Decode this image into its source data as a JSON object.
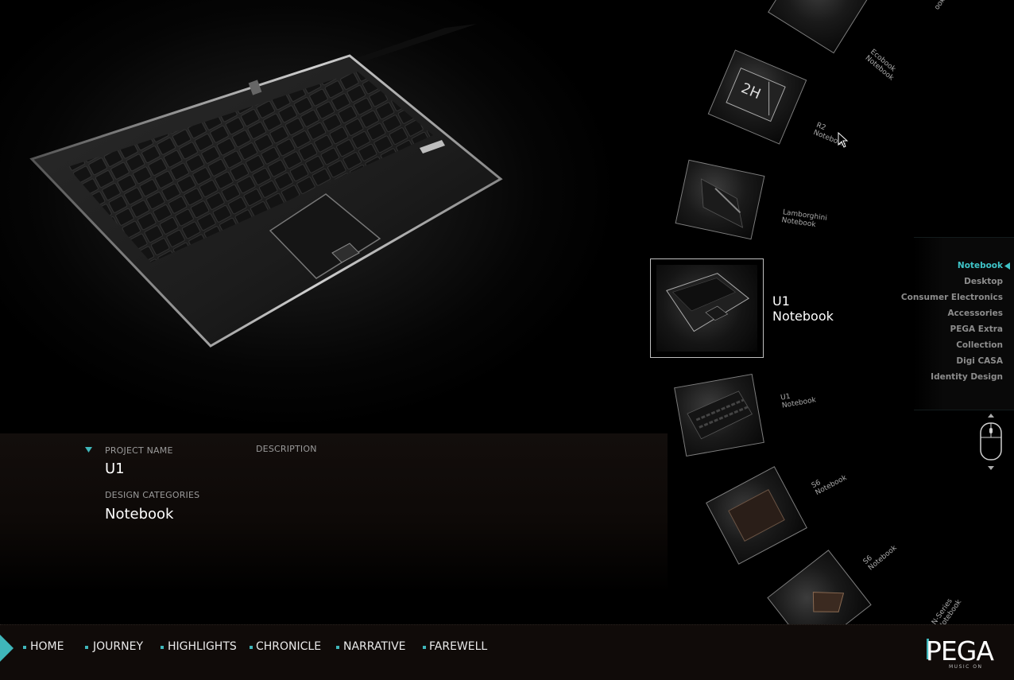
{
  "project": {
    "name_label": "PROJECT NAME",
    "name": "U1",
    "categories_label": "DESIGN CATEGORIES",
    "category": "Notebook",
    "description_label": "DESCRIPTION"
  },
  "carousel": {
    "items": [
      {
        "line1": "",
        "line2": "ook"
      },
      {
        "line1": "Ecobook",
        "line2": "Notebook"
      },
      {
        "line1": "R2",
        "line2": "Notebook"
      },
      {
        "line1": "Lamborghini",
        "line2": "Notebook"
      },
      {
        "line1": "U1",
        "line2": "Notebook"
      },
      {
        "line1": "U1",
        "line2": "Notebook"
      },
      {
        "line1": "S6",
        "line2": "Notebook"
      },
      {
        "line1": "S6",
        "line2": "Notebook"
      },
      {
        "line1": "N-Series",
        "line2": "Notebook"
      }
    ]
  },
  "categories": [
    {
      "label": "Notebook",
      "active": true
    },
    {
      "label": "Desktop",
      "active": false
    },
    {
      "label": "Consumer Electronics",
      "active": false
    },
    {
      "label": "Accessories",
      "active": false
    },
    {
      "label": "PEGA Extra",
      "active": false
    },
    {
      "label": "Collection",
      "active": false
    },
    {
      "label": "Digi CASA",
      "active": false
    },
    {
      "label": "Identity Design",
      "active": false
    }
  ],
  "nav": {
    "items": [
      "HOME",
      "JOURNEY",
      "HIGHLIGHTS",
      "CHRONICLE",
      "NARRATIVE",
      "FAREWELL"
    ]
  },
  "brand": {
    "logo": "PEGA",
    "tagline": "MUSIC ON",
    "accent": "#3fc4c8"
  },
  "icons": {
    "collapse": "triangle-down-icon",
    "menu_pointer": "triangle-left-icon",
    "scroll": "mouse-scroll-icon",
    "nav_toggle": "chevron-right-icon"
  }
}
